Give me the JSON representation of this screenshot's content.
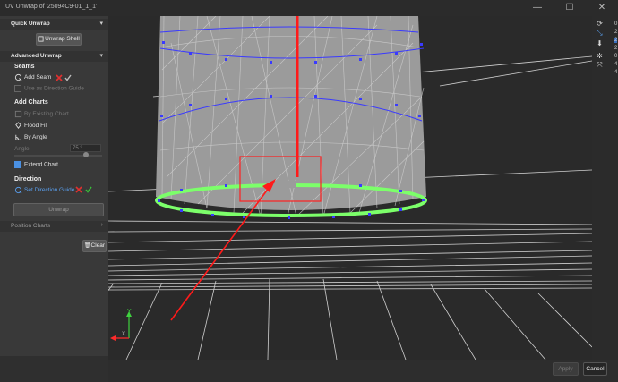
{
  "window": {
    "title": "UV Unwrap of '25094C9-01_1_1'",
    "minimize_glyph": "—",
    "maximize_glyph": "☐",
    "close_glyph": "✕"
  },
  "sidebar": {
    "quick_unwrap": {
      "header": "Quick Unwrap",
      "unwrap_shell_label": "Unwrap Shell"
    },
    "advanced_unwrap": {
      "header": "Advanced Unwrap",
      "seams": {
        "title": "Seams",
        "add_seam_label": "Add Seam",
        "direction_guide_label": "Use as Direction Guide"
      },
      "add_charts": {
        "title": "Add Charts",
        "by_existing_chart": "By Existing Chart",
        "flood_fill": "Flood Fill",
        "by_angle": "By Angle",
        "angle_label": "Angle",
        "angle_value": "75 °",
        "extend_chart_label": "Extend Chart",
        "extend_chart_checked": true
      },
      "direction": {
        "title": "Direction",
        "set_direction_guide_label": "Set Direction Guide"
      },
      "unwrap_label": "Unwrap"
    },
    "position_charts": {
      "header": "Position Charts"
    },
    "clear_label": "Clear"
  },
  "viewport": {
    "axis_y_label": "Y",
    "axis_x_label": "X",
    "colors": {
      "seam_red": "#ff1a1a",
      "seam_green": "#7cff6a",
      "vertex_blue": "#3a3aff",
      "mesh_fill": "#9a9a9a",
      "grid": "#d0d0d0"
    }
  },
  "right_toolbar": {
    "icons": [
      "refresh-icon",
      "fit-view-icon",
      "download-icon",
      "settings-icon",
      "transform-icon"
    ],
    "side_text": [
      "0",
      "2",
      "2",
      "2",
      "0",
      "4",
      "4"
    ]
  },
  "footer": {
    "apply_label": "Apply",
    "cancel_label": "Cancel"
  }
}
